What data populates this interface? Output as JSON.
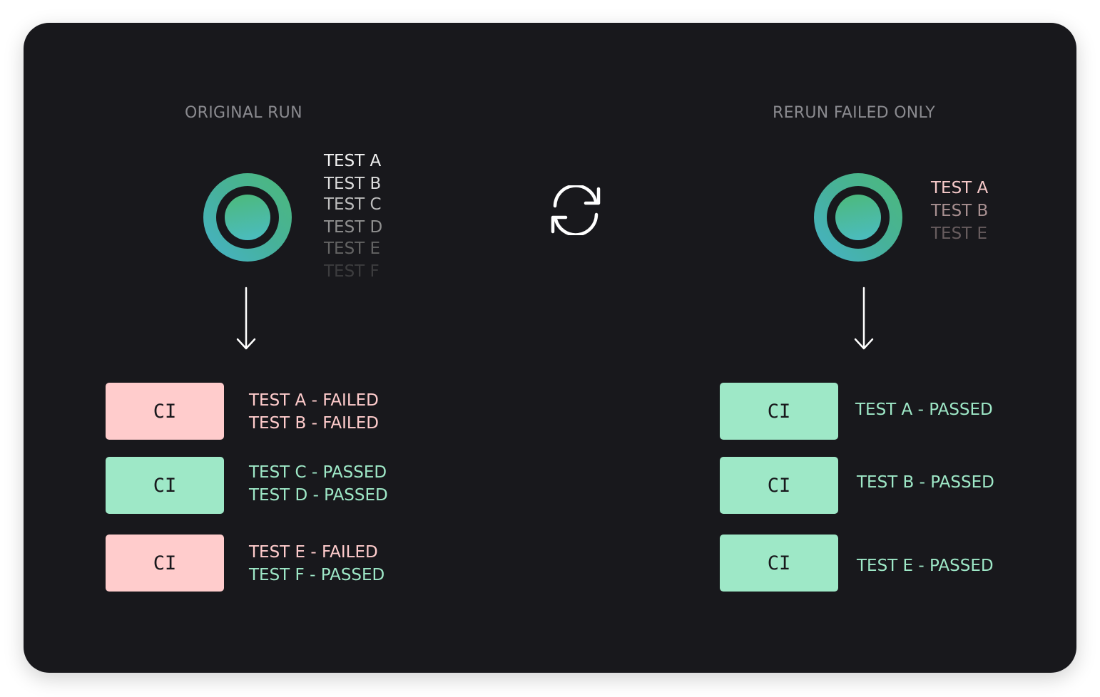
{
  "colors": {
    "background": "#18181c",
    "failed": "#ffcccc",
    "passed": "#9ee8c7",
    "heading": "#8a8a8f",
    "ring_green": "#4cb97a",
    "ring_teal": "#45b3c8"
  },
  "icons": {
    "runner": "ring-icon",
    "flow": "arrow-down-icon",
    "rerun": "refresh-icon"
  },
  "original": {
    "title": "ORIGINAL RUN",
    "queue": [
      "TEST A",
      "TEST B",
      "TEST C",
      "TEST D",
      "TEST E",
      "TEST F"
    ],
    "jobs": [
      {
        "label": "CI",
        "status": "failed",
        "results": [
          {
            "text": "TEST A - FAILED",
            "status": "failed"
          },
          {
            "text": "TEST B - FAILED",
            "status": "failed"
          }
        ]
      },
      {
        "label": "CI",
        "status": "passed",
        "results": [
          {
            "text": "TEST C - PASSED",
            "status": "passed"
          },
          {
            "text": "TEST D - PASSED",
            "status": "passed"
          }
        ]
      },
      {
        "label": "CI",
        "status": "failed",
        "results": [
          {
            "text": "TEST E - FAILED",
            "status": "failed"
          },
          {
            "text": "TEST F - PASSED",
            "status": "passed"
          }
        ]
      }
    ]
  },
  "rerun": {
    "title": "RERUN FAILED ONLY",
    "queue": [
      "TEST A",
      "TEST B",
      "TEST E"
    ],
    "jobs": [
      {
        "label": "CI",
        "status": "passed",
        "results": [
          {
            "text": "TEST A - PASSED",
            "status": "passed"
          }
        ]
      },
      {
        "label": "CI",
        "status": "passed",
        "results": [
          {
            "text": "TEST B - PASSED",
            "status": "passed"
          }
        ]
      },
      {
        "label": "CI",
        "status": "passed",
        "results": [
          {
            "text": "TEST E - PASSED",
            "status": "passed"
          }
        ]
      }
    ]
  }
}
